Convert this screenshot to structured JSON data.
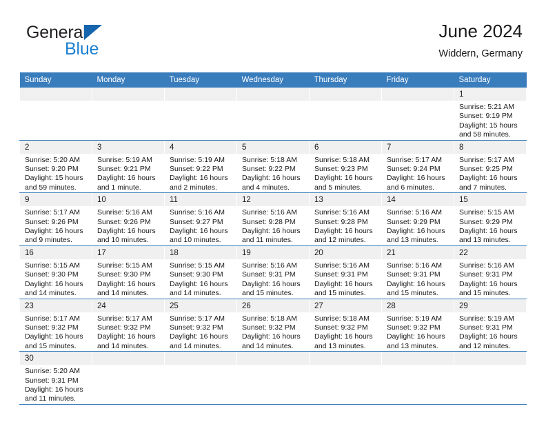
{
  "brand": {
    "name_top": "General",
    "name_bottom": "Blue",
    "triangle_color": "#1565ad",
    "blue_color": "#1b7fd0"
  },
  "header": {
    "title": "June 2024",
    "subtitle": "Widdern, Germany"
  },
  "theme": {
    "header_blue": "#3a7dbd",
    "daynum_bg": "#f0f0f0",
    "text": "#1a1a1a"
  },
  "weekdays": [
    "Sunday",
    "Monday",
    "Tuesday",
    "Wednesday",
    "Thursday",
    "Friday",
    "Saturday"
  ],
  "labels": {
    "sunrise_prefix": "Sunrise: ",
    "sunset_prefix": "Sunset: ",
    "daylight_prefix": "Daylight: "
  },
  "weeks": [
    [
      {
        "day": "",
        "sunrise": "",
        "sunset": "",
        "daylight": ""
      },
      {
        "day": "",
        "sunrise": "",
        "sunset": "",
        "daylight": ""
      },
      {
        "day": "",
        "sunrise": "",
        "sunset": "",
        "daylight": ""
      },
      {
        "day": "",
        "sunrise": "",
        "sunset": "",
        "daylight": ""
      },
      {
        "day": "",
        "sunrise": "",
        "sunset": "",
        "daylight": ""
      },
      {
        "day": "",
        "sunrise": "",
        "sunset": "",
        "daylight": ""
      },
      {
        "day": "1",
        "sunrise": "Sunrise: 5:21 AM",
        "sunset": "Sunset: 9:19 PM",
        "daylight": "Daylight: 15 hours and 58 minutes."
      }
    ],
    [
      {
        "day": "2",
        "sunrise": "Sunrise: 5:20 AM",
        "sunset": "Sunset: 9:20 PM",
        "daylight": "Daylight: 15 hours and 59 minutes."
      },
      {
        "day": "3",
        "sunrise": "Sunrise: 5:19 AM",
        "sunset": "Sunset: 9:21 PM",
        "daylight": "Daylight: 16 hours and 1 minute."
      },
      {
        "day": "4",
        "sunrise": "Sunrise: 5:19 AM",
        "sunset": "Sunset: 9:22 PM",
        "daylight": "Daylight: 16 hours and 2 minutes."
      },
      {
        "day": "5",
        "sunrise": "Sunrise: 5:18 AM",
        "sunset": "Sunset: 9:22 PM",
        "daylight": "Daylight: 16 hours and 4 minutes."
      },
      {
        "day": "6",
        "sunrise": "Sunrise: 5:18 AM",
        "sunset": "Sunset: 9:23 PM",
        "daylight": "Daylight: 16 hours and 5 minutes."
      },
      {
        "day": "7",
        "sunrise": "Sunrise: 5:17 AM",
        "sunset": "Sunset: 9:24 PM",
        "daylight": "Daylight: 16 hours and 6 minutes."
      },
      {
        "day": "8",
        "sunrise": "Sunrise: 5:17 AM",
        "sunset": "Sunset: 9:25 PM",
        "daylight": "Daylight: 16 hours and 7 minutes."
      }
    ],
    [
      {
        "day": "9",
        "sunrise": "Sunrise: 5:17 AM",
        "sunset": "Sunset: 9:26 PM",
        "daylight": "Daylight: 16 hours and 9 minutes."
      },
      {
        "day": "10",
        "sunrise": "Sunrise: 5:16 AM",
        "sunset": "Sunset: 9:26 PM",
        "daylight": "Daylight: 16 hours and 10 minutes."
      },
      {
        "day": "11",
        "sunrise": "Sunrise: 5:16 AM",
        "sunset": "Sunset: 9:27 PM",
        "daylight": "Daylight: 16 hours and 10 minutes."
      },
      {
        "day": "12",
        "sunrise": "Sunrise: 5:16 AM",
        "sunset": "Sunset: 9:28 PM",
        "daylight": "Daylight: 16 hours and 11 minutes."
      },
      {
        "day": "13",
        "sunrise": "Sunrise: 5:16 AM",
        "sunset": "Sunset: 9:28 PM",
        "daylight": "Daylight: 16 hours and 12 minutes."
      },
      {
        "day": "14",
        "sunrise": "Sunrise: 5:16 AM",
        "sunset": "Sunset: 9:29 PM",
        "daylight": "Daylight: 16 hours and 13 minutes."
      },
      {
        "day": "15",
        "sunrise": "Sunrise: 5:15 AM",
        "sunset": "Sunset: 9:29 PM",
        "daylight": "Daylight: 16 hours and 13 minutes."
      }
    ],
    [
      {
        "day": "16",
        "sunrise": "Sunrise: 5:15 AM",
        "sunset": "Sunset: 9:30 PM",
        "daylight": "Daylight: 16 hours and 14 minutes."
      },
      {
        "day": "17",
        "sunrise": "Sunrise: 5:15 AM",
        "sunset": "Sunset: 9:30 PM",
        "daylight": "Daylight: 16 hours and 14 minutes."
      },
      {
        "day": "18",
        "sunrise": "Sunrise: 5:15 AM",
        "sunset": "Sunset: 9:30 PM",
        "daylight": "Daylight: 16 hours and 14 minutes."
      },
      {
        "day": "19",
        "sunrise": "Sunrise: 5:16 AM",
        "sunset": "Sunset: 9:31 PM",
        "daylight": "Daylight: 16 hours and 15 minutes."
      },
      {
        "day": "20",
        "sunrise": "Sunrise: 5:16 AM",
        "sunset": "Sunset: 9:31 PM",
        "daylight": "Daylight: 16 hours and 15 minutes."
      },
      {
        "day": "21",
        "sunrise": "Sunrise: 5:16 AM",
        "sunset": "Sunset: 9:31 PM",
        "daylight": "Daylight: 16 hours and 15 minutes."
      },
      {
        "day": "22",
        "sunrise": "Sunrise: 5:16 AM",
        "sunset": "Sunset: 9:31 PM",
        "daylight": "Daylight: 16 hours and 15 minutes."
      }
    ],
    [
      {
        "day": "23",
        "sunrise": "Sunrise: 5:17 AM",
        "sunset": "Sunset: 9:32 PM",
        "daylight": "Daylight: 16 hours and 15 minutes."
      },
      {
        "day": "24",
        "sunrise": "Sunrise: 5:17 AM",
        "sunset": "Sunset: 9:32 PM",
        "daylight": "Daylight: 16 hours and 14 minutes."
      },
      {
        "day": "25",
        "sunrise": "Sunrise: 5:17 AM",
        "sunset": "Sunset: 9:32 PM",
        "daylight": "Daylight: 16 hours and 14 minutes."
      },
      {
        "day": "26",
        "sunrise": "Sunrise: 5:18 AM",
        "sunset": "Sunset: 9:32 PM",
        "daylight": "Daylight: 16 hours and 14 minutes."
      },
      {
        "day": "27",
        "sunrise": "Sunrise: 5:18 AM",
        "sunset": "Sunset: 9:32 PM",
        "daylight": "Daylight: 16 hours and 13 minutes."
      },
      {
        "day": "28",
        "sunrise": "Sunrise: 5:19 AM",
        "sunset": "Sunset: 9:32 PM",
        "daylight": "Daylight: 16 hours and 13 minutes."
      },
      {
        "day": "29",
        "sunrise": "Sunrise: 5:19 AM",
        "sunset": "Sunset: 9:31 PM",
        "daylight": "Daylight: 16 hours and 12 minutes."
      }
    ],
    [
      {
        "day": "30",
        "sunrise": "Sunrise: 5:20 AM",
        "sunset": "Sunset: 9:31 PM",
        "daylight": "Daylight: 16 hours and 11 minutes."
      },
      {
        "day": "",
        "sunrise": "",
        "sunset": "",
        "daylight": ""
      },
      {
        "day": "",
        "sunrise": "",
        "sunset": "",
        "daylight": ""
      },
      {
        "day": "",
        "sunrise": "",
        "sunset": "",
        "daylight": ""
      },
      {
        "day": "",
        "sunrise": "",
        "sunset": "",
        "daylight": ""
      },
      {
        "day": "",
        "sunrise": "",
        "sunset": "",
        "daylight": ""
      },
      {
        "day": "",
        "sunrise": "",
        "sunset": "",
        "daylight": ""
      }
    ]
  ]
}
